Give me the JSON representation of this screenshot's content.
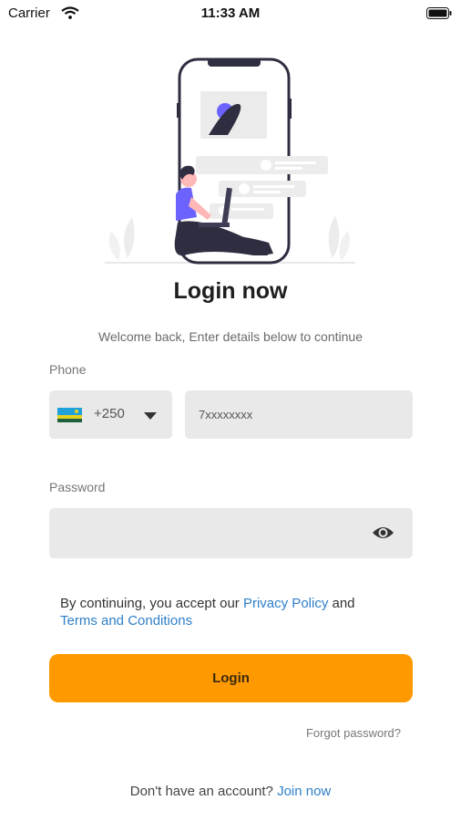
{
  "status_bar": {
    "carrier": "Carrier",
    "time": "11:33 AM"
  },
  "header": {
    "title": "Login now",
    "subtitle": "Welcome back, Enter details below to continue"
  },
  "phone": {
    "label": "Phone",
    "country_code": "+250",
    "value": "7xxxxxxxx"
  },
  "password": {
    "label": "Password",
    "value": ""
  },
  "terms": {
    "prefix": "By continuing, you accept our ",
    "privacy_link": "Privacy Policy",
    "middle": " and",
    "terms_link": "Terms and Conditions"
  },
  "login_button": "Login",
  "forgot_password": "Forgot password?",
  "signup": {
    "prompt": "Don't have an account?",
    "link": "Join now"
  },
  "colors": {
    "accent": "#fe9a00",
    "link": "#2f7fc8",
    "field_bg": "#e9e9e9",
    "illustration": "#6c63ff"
  },
  "icons": {
    "wifi": "wifi-icon",
    "battery": "battery-icon",
    "flag": "rwanda-flag-icon",
    "dropdown": "caret-down-icon",
    "visibility": "eye-icon"
  }
}
